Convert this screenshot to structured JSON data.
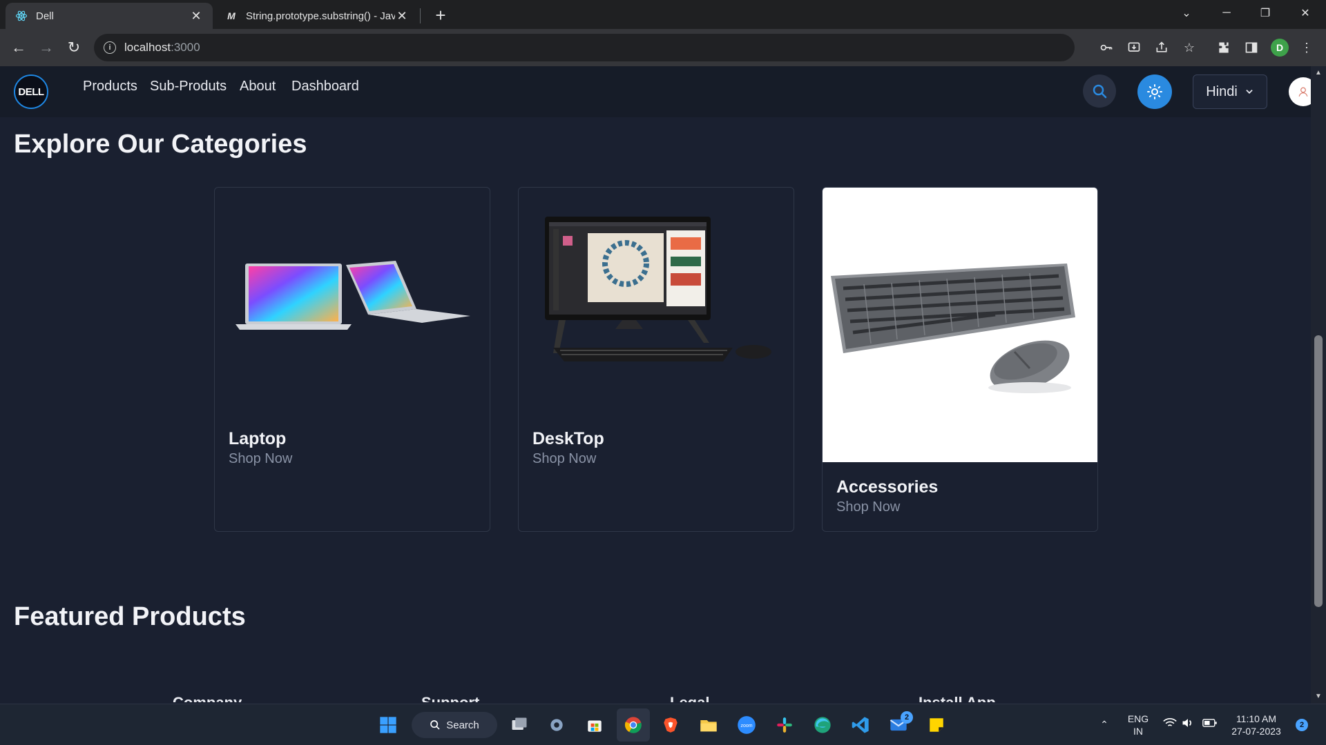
{
  "browser": {
    "tabs": [
      {
        "title": "Dell",
        "active": true
      },
      {
        "title": "String.prototype.substring() - JavaScript | MDN",
        "active": false
      }
    ],
    "url_host": "localhost",
    "url_port": ":3000",
    "profile_initial": "D"
  },
  "navbar": {
    "logo_text": "DELL",
    "links": [
      "Products",
      "Sub-Produts",
      "About",
      "Dashboard"
    ],
    "language": "Hindi"
  },
  "categories": {
    "title": "Explore Our Categories",
    "cards": [
      {
        "name": "Laptop",
        "cta": "Shop Now"
      },
      {
        "name": "DeskTop",
        "cta": "Shop Now"
      },
      {
        "name": "Accessories",
        "cta": "Shop Now"
      }
    ]
  },
  "featured": {
    "title": "Featured Products"
  },
  "footer_peek": [
    "Company",
    "Support",
    "Legal",
    "Install App"
  ],
  "taskbar": {
    "search_label": "Search",
    "lang_line1": "ENG",
    "lang_line2": "IN",
    "time": "11:10 AM",
    "date": "27-07-2023",
    "mail_badge": "2",
    "notif_badge": "2"
  }
}
